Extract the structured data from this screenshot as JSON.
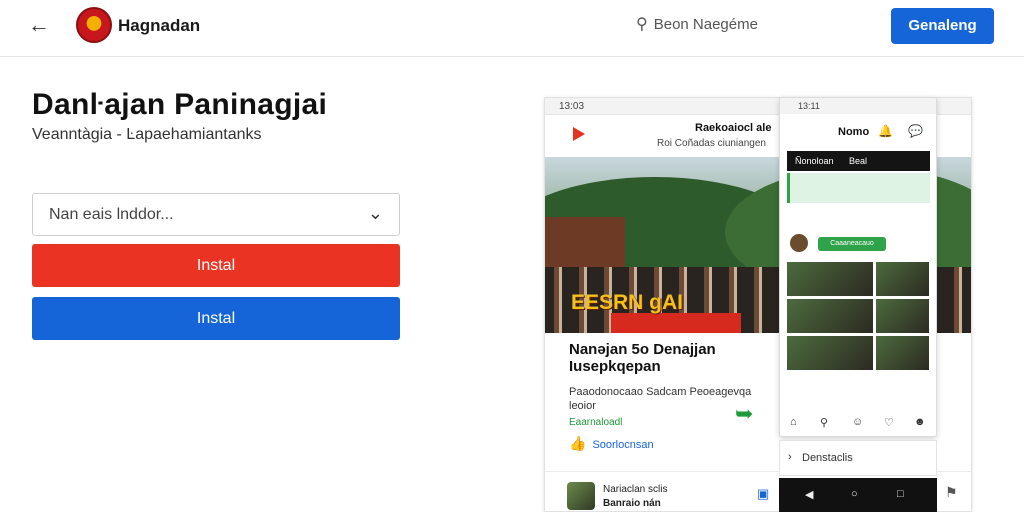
{
  "topbar": {
    "brand": "Hagnadan",
    "search_label": "Beon Naegéme",
    "cta_label": "Genaleng"
  },
  "hero": {
    "title": "Danŀajan Paninagjai",
    "subtitle": "Veanntàgia - Ŀapaehamiantanks"
  },
  "form": {
    "select_value": "Nan eais lnddor...",
    "install_red": "Instal",
    "install_blue": "Instal"
  },
  "mockup_large": {
    "status_time": "13:03",
    "header_title": "Raekoaiocl ale",
    "header_subtitle": "Roi Coñadas ciuniangen",
    "photo_sign": "EESRN gAI",
    "article_title": "Nanəjan 5o Denajjan Iusepkqepan",
    "article_body": "Paaodonocaao Sadcam Peoeagevqa leoior",
    "green_text": "Eaarnaloadl",
    "like_text": "Soorlocnsan",
    "footer_name": "Nariaclan sclis",
    "footer_sub": "Banraio nán"
  },
  "mockup_phone": {
    "status_time": "13:11",
    "header_name": "Nomo",
    "bar_left": "Ñonoloan",
    "bar_right": "Beal",
    "pill_label": "Caaaneacauo",
    "collapse_label": "Denstaclis"
  }
}
